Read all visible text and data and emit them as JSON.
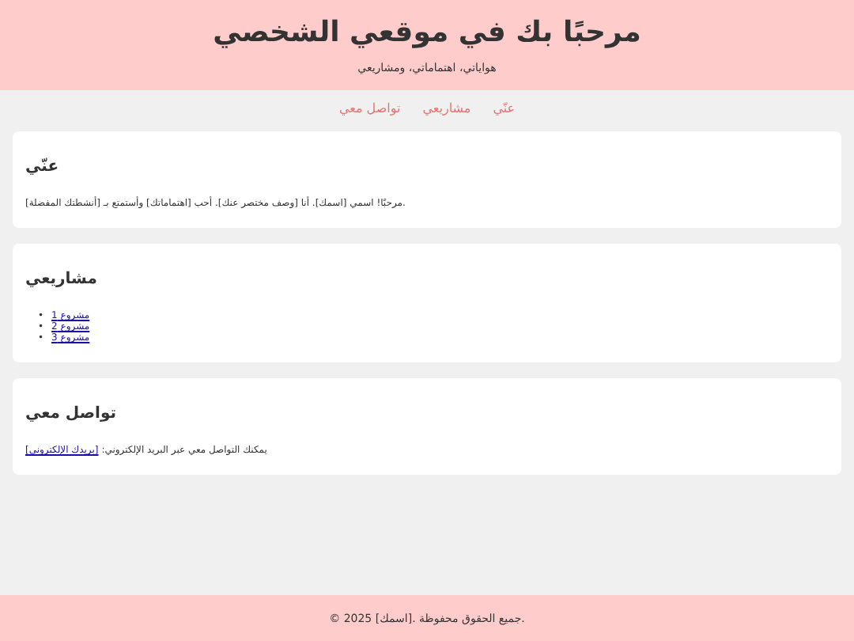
{
  "header": {
    "title": "مرحبًا بك في موقعي الشخصي",
    "subtitle": "هواياتي، اهتماماتي، ومشاريعي"
  },
  "nav": [
    "عنّي",
    "مشاريعي",
    "تواصل معي"
  ],
  "sections": [
    {
      "kind": "text",
      "heading": "عنّي",
      "text": "مرحبًا! اسمي [اسمك]. أنا [وصف مختصر عنك]. أحب [اهتماماتك] وأستمتع بـ [أنشطتك المفضلة]."
    },
    {
      "kind": "list",
      "heading": "مشاريعي",
      "items": [
        {
          "marker": "•",
          "label": "مشروع 1"
        },
        {
          "marker": "•",
          "label": "مشروع 2"
        },
        {
          "marker": "•",
          "label": "مشروع 3"
        }
      ]
    },
    {
      "kind": "contact",
      "heading": "تواصل معي",
      "text": "يمكنك التواصل معي عبر البريد الإلكتروني:",
      "link": "[بريدك الإلكتروني]"
    }
  ],
  "footer": "© 2025 [اسمك]. جميع الحقوق محفوظة."
}
